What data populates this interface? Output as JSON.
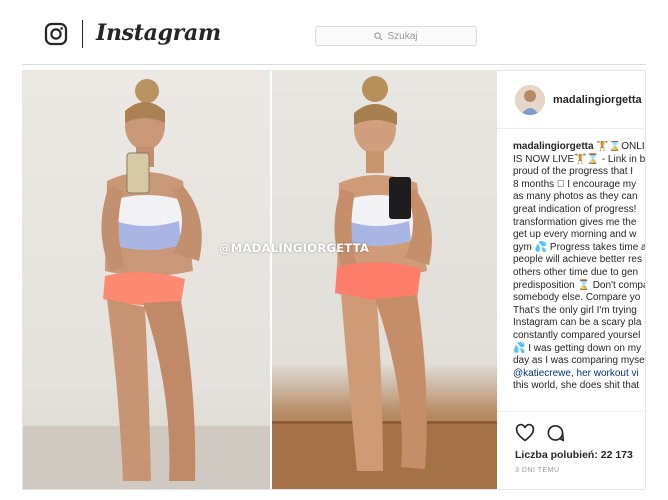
{
  "header": {
    "brand": "Instagram",
    "search_placeholder": "Szukaj"
  },
  "post": {
    "watermark": "@MADALINGIORGETTA",
    "author": "madalingiorgetta",
    "caption": {
      "username": "madalingiorgetta",
      "lines": [
        " 🏋⌛ONLINE",
        "IS NOW LIVE🏋⌛ - Link in bio",
        "proud of the progress that I",
        "8 months 🏻 I encourage my",
        "as many photos as they can",
        "great indication of progress!",
        "transformation gives me the",
        "get up every morning and w",
        "gym 💦 Progress takes time a",
        "people will achieve better res",
        "others other time due to gen",
        "predisposition ⌛ Don't compa",
        "somebody else. Compare yo",
        "That's the only girl I'm trying",
        "Instagram can be a scary pla",
        "constantly compared yoursel",
        "💦 I was getting down on my",
        "day as I was comparing myse",
        "@katiecrewe, her workout vi",
        "this world, she does shit that"
      ],
      "mention": "@katiecrewe"
    },
    "likes_label": "Liczba polubień: 22 173",
    "timestamp": "3 DNI TEMU"
  }
}
